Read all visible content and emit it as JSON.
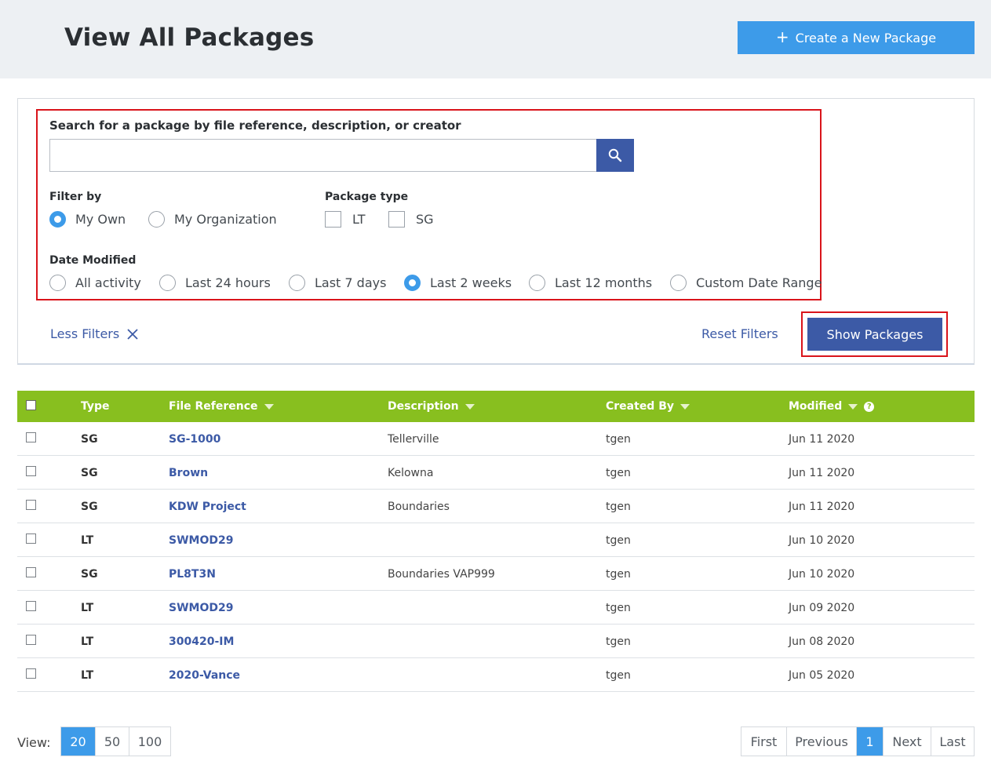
{
  "header": {
    "title": "View All Packages",
    "create_button": "Create a New Package",
    "create_icon": "+"
  },
  "filters": {
    "search_label": "Search for a package by file reference, description, or creator",
    "search_value": "",
    "filter_by_label": "Filter by",
    "filter_by_options": [
      {
        "label": "My Own",
        "selected": true
      },
      {
        "label": "My Organization",
        "selected": false
      }
    ],
    "package_type_label": "Package type",
    "package_type_options": [
      {
        "label": "LT",
        "checked": false
      },
      {
        "label": "SG",
        "checked": false
      }
    ],
    "date_modified_label": "Date Modified",
    "date_options": [
      {
        "label": "All activity",
        "selected": false
      },
      {
        "label": "Last 24 hours",
        "selected": false
      },
      {
        "label": "Last 7 days",
        "selected": false
      },
      {
        "label": "Last 2 weeks",
        "selected": true
      },
      {
        "label": "Last 12 months",
        "selected": false
      },
      {
        "label": "Custom Date Range",
        "selected": false
      }
    ],
    "less_filters": "Less Filters",
    "reset_filters": "Reset Filters",
    "show_packages": "Show Packages"
  },
  "table": {
    "columns": [
      "Type",
      "File Reference",
      "Description",
      "Created By",
      "Modified"
    ],
    "help_icon": "?",
    "rows": [
      {
        "type": "SG",
        "ref": "SG-1000",
        "desc": "Tellerville",
        "by": "tgen",
        "modified": "Jun 11 2020"
      },
      {
        "type": "SG",
        "ref": "Brown",
        "desc": "Kelowna",
        "by": "tgen",
        "modified": "Jun 11 2020"
      },
      {
        "type": "SG",
        "ref": "KDW Project",
        "desc": "Boundaries",
        "by": "tgen",
        "modified": "Jun 11 2020"
      },
      {
        "type": "LT",
        "ref": "SWMOD29",
        "desc": "",
        "by": "tgen",
        "modified": "Jun 10 2020"
      },
      {
        "type": "SG",
        "ref": "PL8T3N",
        "desc": "Boundaries VAP999",
        "by": "tgen",
        "modified": "Jun 10 2020"
      },
      {
        "type": "LT",
        "ref": "SWMOD29",
        "desc": "",
        "by": "tgen",
        "modified": "Jun 09 2020"
      },
      {
        "type": "LT",
        "ref": "300420-IM",
        "desc": "",
        "by": "tgen",
        "modified": "Jun 08 2020"
      },
      {
        "type": "LT",
        "ref": "2020-Vance",
        "desc": "",
        "by": "tgen",
        "modified": "Jun 05 2020"
      }
    ]
  },
  "footer": {
    "view_label": "View:",
    "page_sizes": [
      {
        "label": "20",
        "active": true
      },
      {
        "label": "50",
        "active": false
      },
      {
        "label": "100",
        "active": false
      }
    ],
    "pagination": [
      {
        "label": "First",
        "active": false
      },
      {
        "label": "Previous",
        "active": false
      },
      {
        "label": "1",
        "active": true
      },
      {
        "label": "Next",
        "active": false
      },
      {
        "label": "Last",
        "active": false
      }
    ]
  },
  "colors": {
    "accent_blue": "#3d9be9",
    "navy": "#3c5aa6",
    "table_header_green": "#88bf1f",
    "highlight_red": "#d9141b"
  }
}
